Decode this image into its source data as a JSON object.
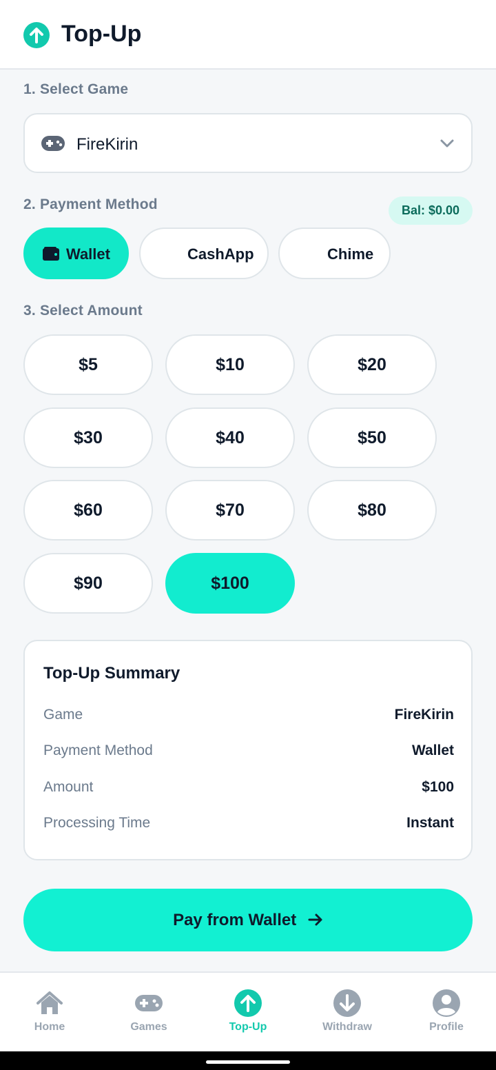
{
  "header": {
    "title": "Top-Up",
    "icon": "arrow-up-circle-icon",
    "icon_color": "#12c9ad"
  },
  "sections": {
    "game_label": "1. Select Game",
    "payment_label": "2. Payment Method",
    "amount_label": "3. Select Amount"
  },
  "game_select": {
    "value": "FireKirin",
    "icon": "gamepad-icon"
  },
  "balance_badge": "Bal: $0.00",
  "payment_methods": [
    {
      "label": "Wallet",
      "selected": true,
      "icon": "wallet-icon"
    },
    {
      "label": "CashApp",
      "selected": false
    },
    {
      "label": "Chime",
      "selected": false
    }
  ],
  "amounts": [
    {
      "label": "$5",
      "selected": false
    },
    {
      "label": "$10",
      "selected": false
    },
    {
      "label": "$20",
      "selected": false
    },
    {
      "label": "$30",
      "selected": false
    },
    {
      "label": "$40",
      "selected": false
    },
    {
      "label": "$50",
      "selected": false
    },
    {
      "label": "$60",
      "selected": false
    },
    {
      "label": "$70",
      "selected": false
    },
    {
      "label": "$80",
      "selected": false
    },
    {
      "label": "$90",
      "selected": false
    },
    {
      "label": "$100",
      "selected": true
    }
  ],
  "summary": {
    "title": "Top-Up Summary",
    "rows": [
      {
        "key": "Game",
        "value": "FireKirin"
      },
      {
        "key": "Payment Method",
        "value": "Wallet"
      },
      {
        "key": "Amount",
        "value": "$100"
      },
      {
        "key": "Processing Time",
        "value": "Instant"
      }
    ]
  },
  "pay_button": {
    "label": "Pay from Wallet",
    "icon": "arrow-right-icon"
  },
  "bottom_nav": [
    {
      "label": "Home",
      "icon": "home-icon",
      "active": false
    },
    {
      "label": "Games",
      "icon": "gamepad-icon",
      "active": false
    },
    {
      "label": "Top-Up",
      "icon": "arrow-up-circle-icon",
      "active": true
    },
    {
      "label": "Withdraw",
      "icon": "arrow-down-circle-icon",
      "active": false
    },
    {
      "label": "Profile",
      "icon": "user-circle-icon",
      "active": false
    }
  ],
  "colors": {
    "accent": "#12eccf",
    "muted": "#9aa5b1",
    "text": "#0f1a2b"
  }
}
